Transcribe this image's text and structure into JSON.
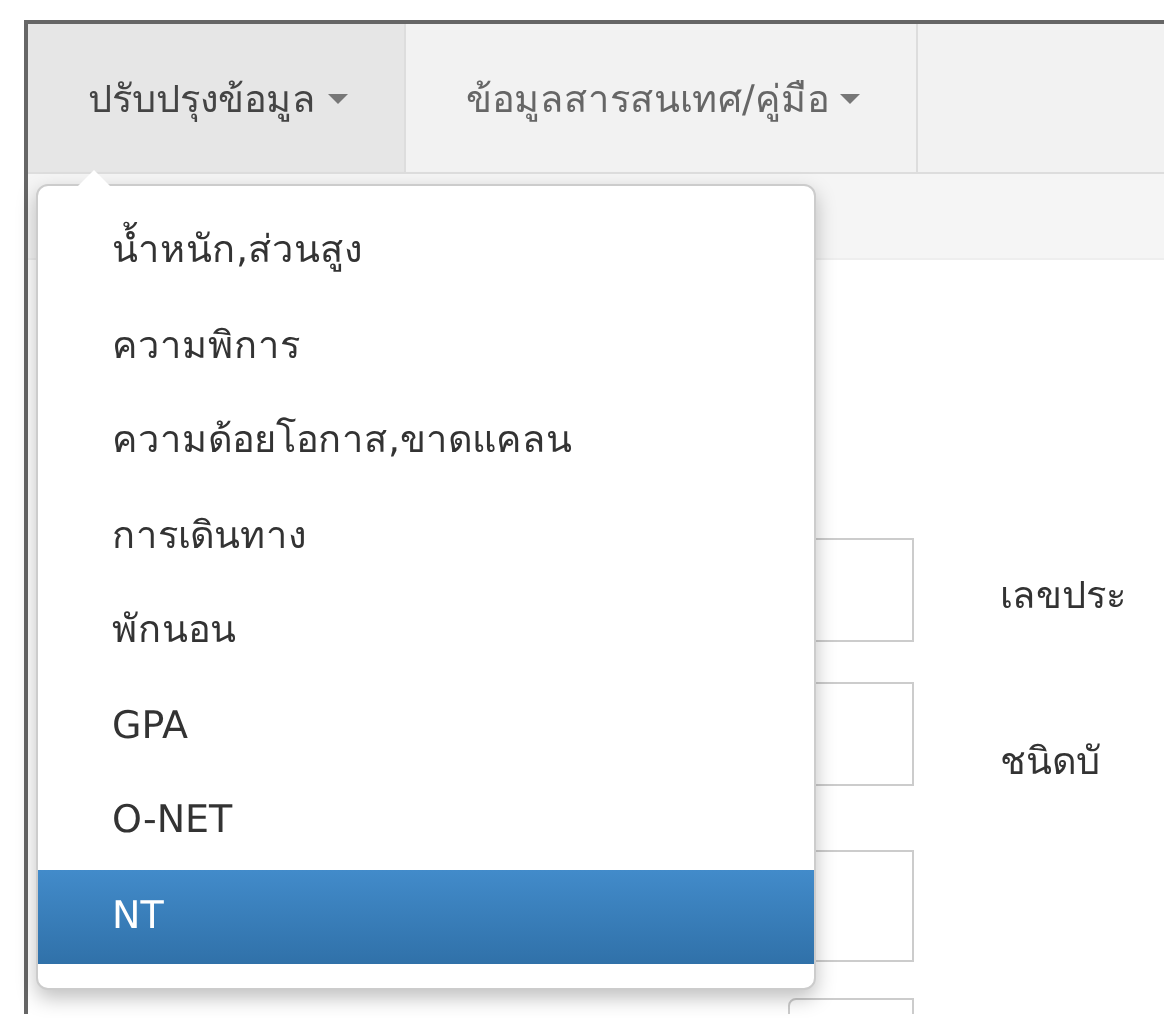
{
  "navbar": {
    "menus": [
      {
        "label": "ปรับปรุงข้อมูล",
        "selected": true
      },
      {
        "label": "ข้อมูลสารสนเทศ/คู่มือ",
        "selected": false
      }
    ]
  },
  "dropdown": {
    "items": [
      {
        "label": "น้ำหนัก,ส่วนสูง",
        "selected": false
      },
      {
        "label": "ความพิการ",
        "selected": false
      },
      {
        "label": "ความด้อยโอกาส,ขาดแคลน",
        "selected": false
      },
      {
        "label": "การเดินทาง",
        "selected": false
      },
      {
        "label": "พักนอน",
        "selected": false
      },
      {
        "label": "GPA",
        "selected": false
      },
      {
        "label": "O-NET",
        "selected": false
      },
      {
        "label": "NT",
        "selected": true
      }
    ]
  },
  "form": {
    "labels": [
      "เลขประ",
      "ชนิดบั"
    ]
  }
}
